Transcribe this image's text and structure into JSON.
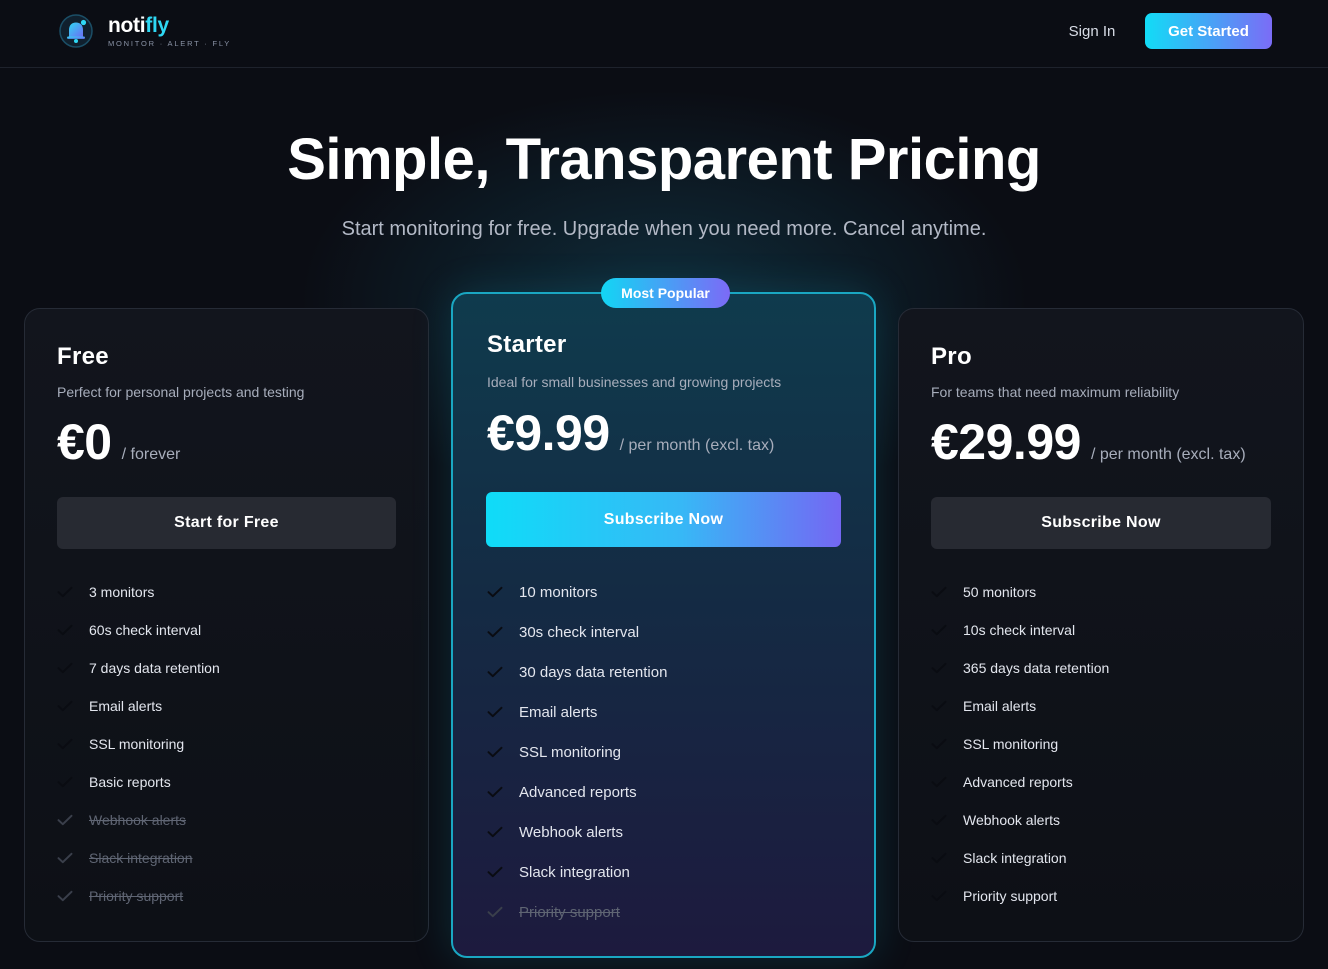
{
  "header": {
    "brand_prefix": "noti",
    "brand_suffix": "fly",
    "tagline": "MONITOR · ALERT · FLY",
    "sign_in": "Sign In",
    "get_started": "Get Started"
  },
  "hero": {
    "title": "Simple, Transparent Pricing",
    "subtitle": "Start monitoring for free. Upgrade when you need more. Cancel anytime."
  },
  "plans": [
    {
      "name": "Free",
      "description": "Perfect for personal projects and testing",
      "price": "€0",
      "period": "/ forever",
      "cta": "Start for Free",
      "features": [
        {
          "label": "3 monitors",
          "included": true
        },
        {
          "label": "60s check interval",
          "included": true
        },
        {
          "label": "7 days data retention",
          "included": true
        },
        {
          "label": "Email alerts",
          "included": true
        },
        {
          "label": "SSL monitoring",
          "included": true
        },
        {
          "label": "Basic reports",
          "included": true
        },
        {
          "label": "Webhook alerts",
          "included": false
        },
        {
          "label": "Slack integration",
          "included": false
        },
        {
          "label": "Priority support",
          "included": false
        }
      ]
    },
    {
      "name": "Starter",
      "badge": "Most Popular",
      "description": "Ideal for small businesses and growing projects",
      "price": "€9.99",
      "period": "/ per month (excl. tax)",
      "cta": "Subscribe Now",
      "features": [
        {
          "label": "10 monitors",
          "included": true
        },
        {
          "label": "30s check interval",
          "included": true
        },
        {
          "label": "30 days data retention",
          "included": true
        },
        {
          "label": "Email alerts",
          "included": true
        },
        {
          "label": "SSL monitoring",
          "included": true
        },
        {
          "label": "Advanced reports",
          "included": true
        },
        {
          "label": "Webhook alerts",
          "included": true
        },
        {
          "label": "Slack integration",
          "included": true
        },
        {
          "label": "Priority support",
          "included": false
        }
      ]
    },
    {
      "name": "Pro",
      "description": "For teams that need maximum reliability",
      "price": "€29.99",
      "period": "/ per month (excl. tax)",
      "cta": "Subscribe Now",
      "features": [
        {
          "label": "50 monitors",
          "included": true
        },
        {
          "label": "10s check interval",
          "included": true
        },
        {
          "label": "365 days data retention",
          "included": true
        },
        {
          "label": "Email alerts",
          "included": true
        },
        {
          "label": "SSL monitoring",
          "included": true
        },
        {
          "label": "Advanced reports",
          "included": true
        },
        {
          "label": "Webhook alerts",
          "included": true
        },
        {
          "label": "Slack integration",
          "included": true
        },
        {
          "label": "Priority support",
          "included": true
        }
      ]
    }
  ],
  "icons": {
    "logo": "bell-logo-icon",
    "feature": "check-icon"
  },
  "colors": {
    "background": "#0b0d14",
    "accent_cyan": "#12dcf6",
    "accent_violet": "#7b6cf6",
    "highlight_border": "#1aa7c2"
  }
}
